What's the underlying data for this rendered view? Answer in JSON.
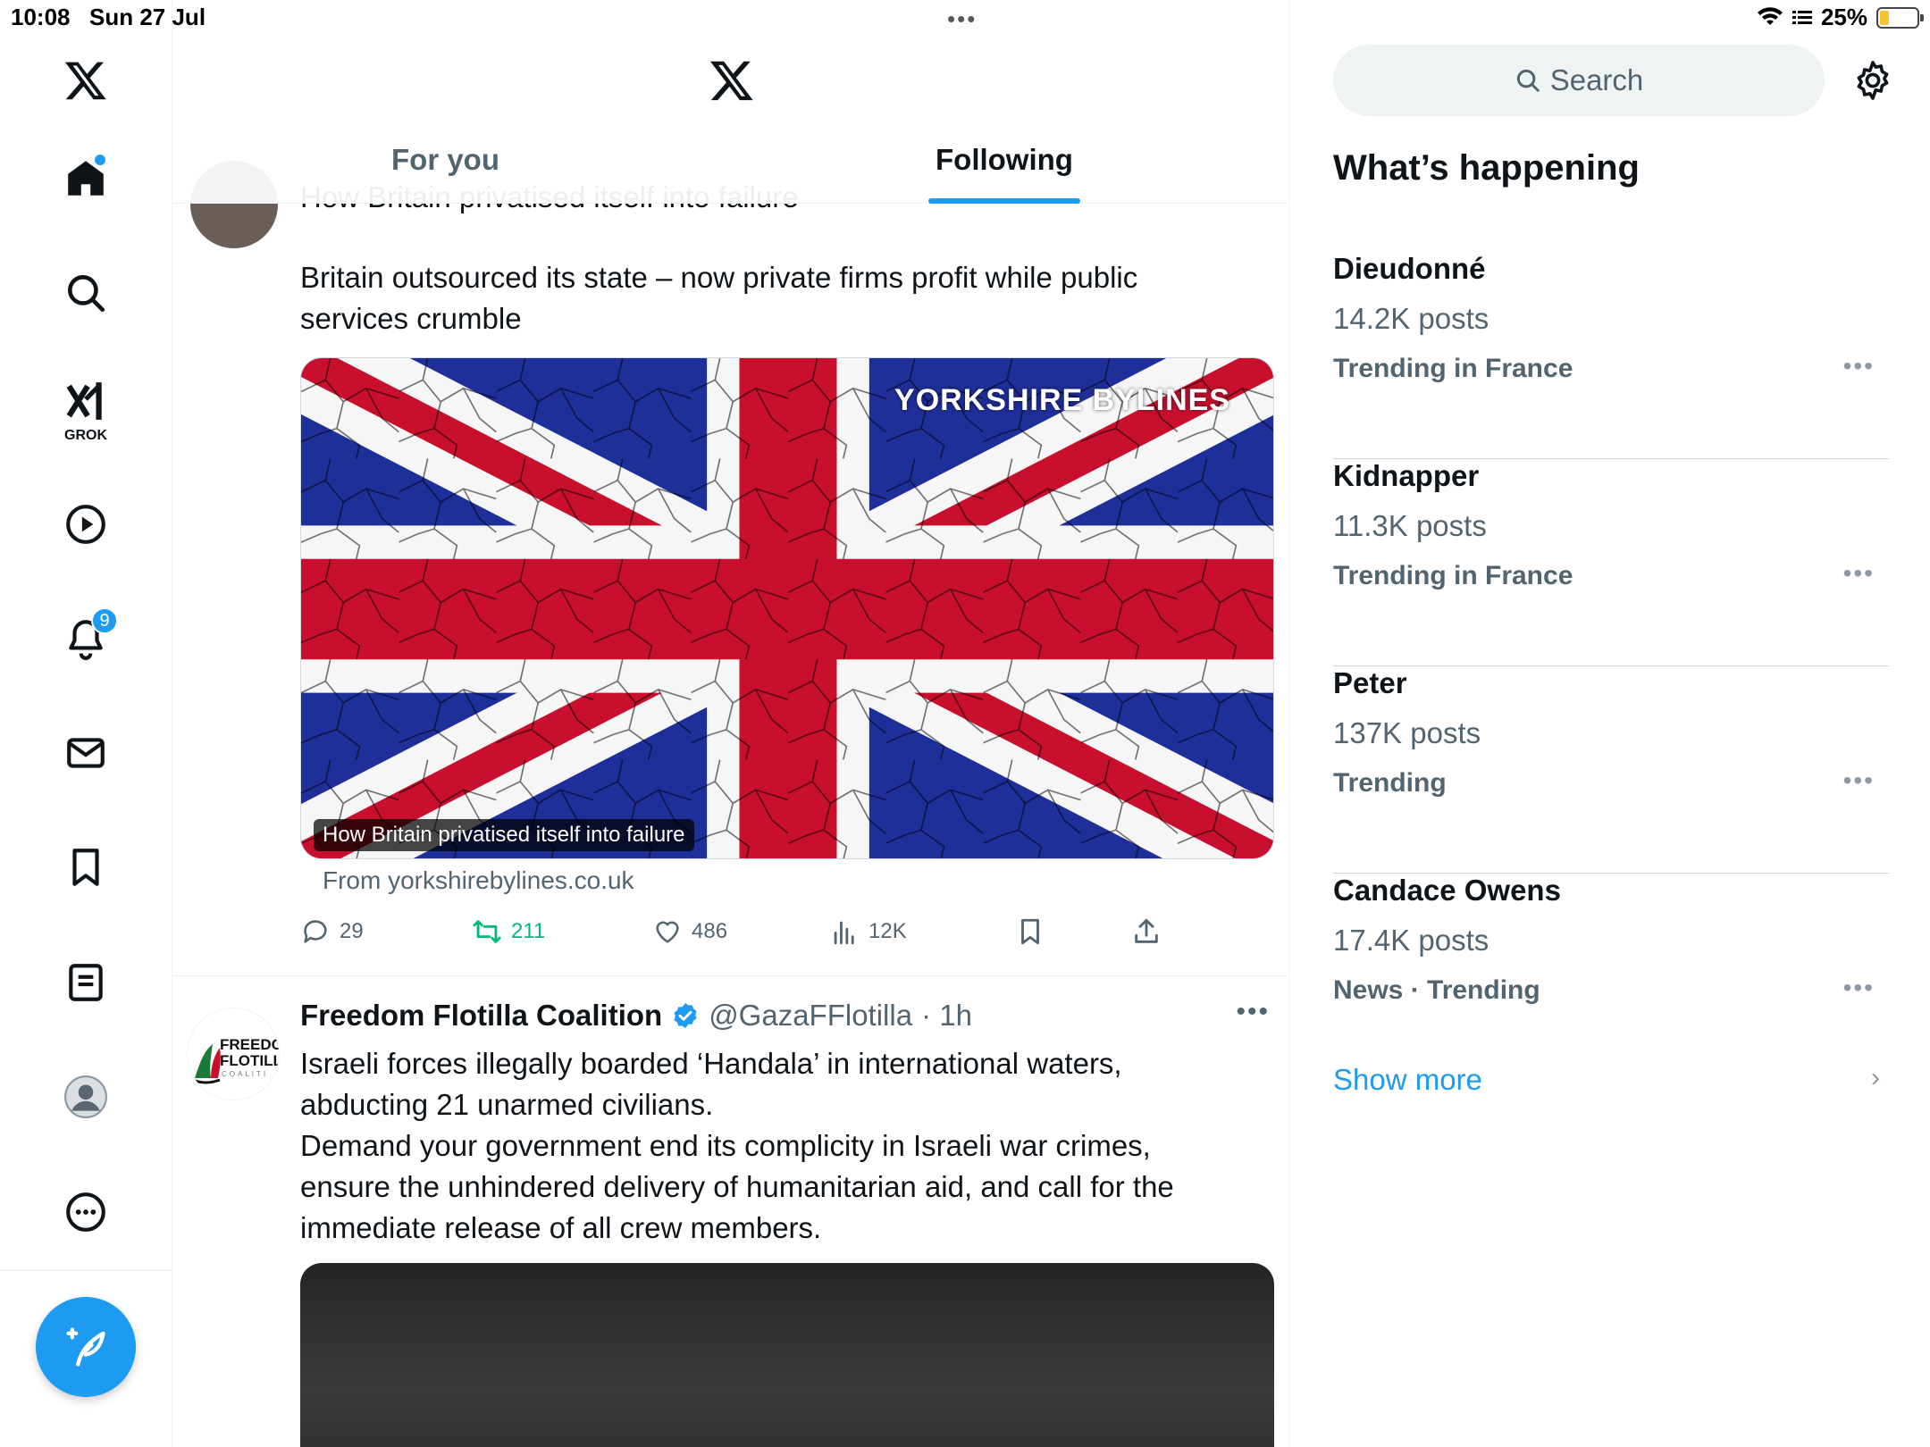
{
  "status_bar": {
    "time": "10:08",
    "date": "Sun 27 Jul",
    "battery": "25%",
    "battery_level": 0.25
  },
  "nav": {
    "items": [
      "home",
      "explore",
      "grok",
      "video",
      "notifications",
      "messages",
      "bookmarks",
      "lists",
      "profile",
      "more"
    ],
    "grok_label": "GROK",
    "notifications_badge": "9"
  },
  "header": {
    "tabs": [
      {
        "label": "For you",
        "active": false
      },
      {
        "label": "Following",
        "active": true
      }
    ]
  },
  "feed": {
    "post1": {
      "partial_title": "How Britain privatised itself into failure",
      "text": "Britain outsourced its state – now private firms profit while public services crumble",
      "card_caption": "How Britain privatised itself into failure",
      "card_brand": "YORKSHIRE BYLINES",
      "card_source": "From yorkshirebylines.co.uk",
      "replies": "29",
      "reposts": "211",
      "likes": "486",
      "views": "12K"
    },
    "post2": {
      "name": "Freedom Flotilla Coalition",
      "handle": "@GazaFFlotilla",
      "time": "· 1h",
      "avatar_text": "FREEDOM FLOTILLA COALITION",
      "text_lines": [
        "Israeli forces illegally boarded ‘Handala’ in international waters, abducting 21 unarmed civilians.",
        "Demand your government end its complicity in Israeli war crimes, ensure the unhindered delivery of humanitarian aid, and call for the immediate release of all crew members."
      ]
    }
  },
  "sidebar": {
    "search_placeholder": "Search",
    "title": "What’s happening",
    "trends": [
      {
        "name": "Dieudonné",
        "count": "14.2K posts",
        "category": "Trending in France"
      },
      {
        "name": "Kidnapper",
        "count": "11.3K posts",
        "category": "Trending in France"
      },
      {
        "name": "Peter",
        "count": "137K posts",
        "category": "Trending"
      },
      {
        "name": "Candace Owens",
        "count": "17.4K posts",
        "category": "News · Trending"
      }
    ],
    "show_more": "Show more"
  },
  "colors": {
    "accent": "#1d9bf0",
    "repost": "#00ba7c",
    "secondary_text": "#536471"
  }
}
